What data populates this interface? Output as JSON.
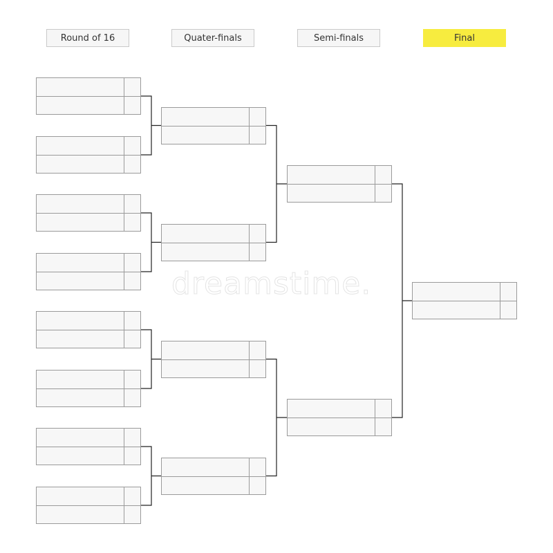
{
  "rounds": [
    {
      "label": "Round of 16",
      "highlight": false,
      "matches": 8
    },
    {
      "label": "Quater-finals",
      "highlight": false,
      "matches": 4
    },
    {
      "label": "Semi-finals",
      "highlight": false,
      "matches": 2
    },
    {
      "label": "Final",
      "highlight": true,
      "matches": 1
    }
  ],
  "colors": {
    "final_header": "#f7ec3f",
    "box_fill": "#f7f7f7",
    "box_border": "#9a9a9a",
    "connector": "#222222"
  },
  "watermark": "dreamstime"
}
